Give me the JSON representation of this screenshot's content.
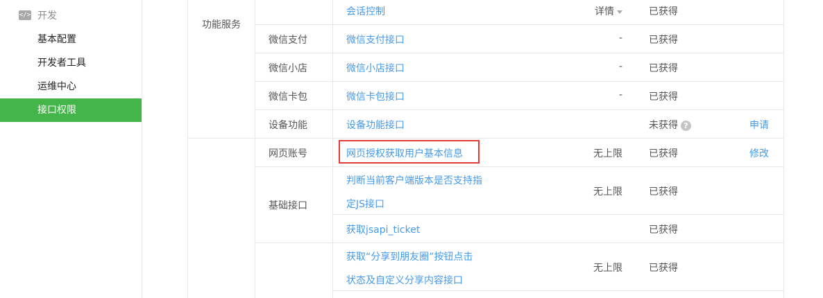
{
  "sidebar": {
    "section_icon": "code-icon",
    "section_icon_glyph": "</>",
    "section_label": "开发",
    "items": [
      {
        "label": "基本配置"
      },
      {
        "label": "开发者工具"
      },
      {
        "label": "运维中心"
      },
      {
        "label": "接口权限",
        "active": true
      }
    ]
  },
  "table": {
    "groups": [
      {
        "label": "功能服务"
      },
      {
        "label": "网页账号"
      },
      {
        "label": "基础接口"
      }
    ],
    "rows": [
      {
        "sub": "",
        "name": "会话控制",
        "limit": "详情",
        "status": "已获得",
        "action": ""
      },
      {
        "sub": "微信支付",
        "name": "微信支付接口",
        "limit": "-",
        "status": "已获得",
        "action": ""
      },
      {
        "sub": "微信小店",
        "name": "微信小店接口",
        "limit": "-",
        "status": "已获得",
        "action": ""
      },
      {
        "sub": "微信卡包",
        "name": "微信卡包接口",
        "limit": "-",
        "status": "已获得",
        "action": ""
      },
      {
        "sub": "设备功能",
        "name": "设备功能接口",
        "limit": "",
        "status": "未获得",
        "action": "申请"
      },
      {
        "name": "网页授权获取用户基本信息",
        "limit": "无上限",
        "status": "已获得",
        "action": "修改"
      },
      {
        "name_line1": "判断当前客户端版本是否支持指",
        "name_line2": "定JS接口",
        "limit": "无上限",
        "status": "已获得"
      },
      {
        "name": "获取jsapi_ticket",
        "limit": "",
        "status": "已获得"
      },
      {
        "name_line1": "获取“分享到朋友圈”按钮点击",
        "name_line2": "状态及自定义分享内容接口",
        "limit": "无上限",
        "status": "已获得"
      }
    ],
    "help_glyph": "?"
  },
  "colors": {
    "accent": "#44b549",
    "link": "#459ae9",
    "highlight": "#e53935",
    "border": "#e7e7eb"
  }
}
